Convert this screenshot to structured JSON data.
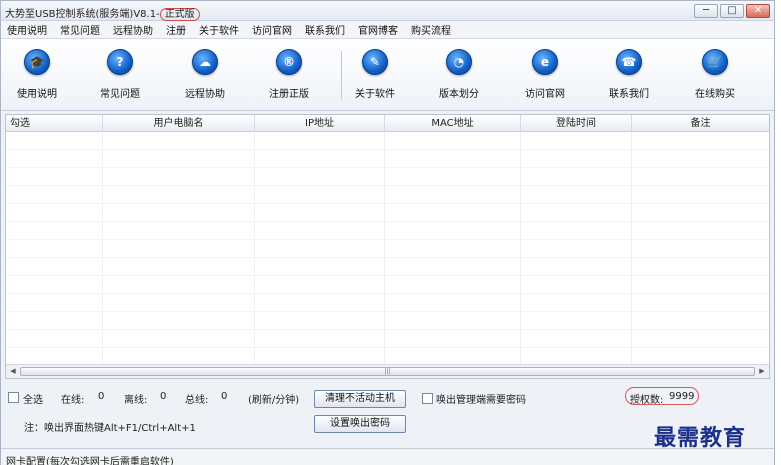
{
  "window": {
    "title_main": "大势至USB控制系统(服务端)V8.1-",
    "title_edition": "正式版",
    "controls": {
      "minimize": "─",
      "maximize": "□",
      "close": "✕"
    }
  },
  "menu": [
    "使用说明",
    "常见问题",
    "远程协助",
    "注册",
    "关于软件",
    "访问官网",
    "联系我们",
    "官网博客",
    "购买流程"
  ],
  "toolbar": {
    "buttons": [
      {
        "label": "使用说明",
        "icon": "graduation-cap-icon",
        "glyph": "🎓"
      },
      {
        "label": "常见问题",
        "icon": "question-icon",
        "glyph": "?"
      },
      {
        "label": "远程协助",
        "icon": "remote-assist-icon",
        "glyph": "☁"
      },
      {
        "label": "注册正版",
        "icon": "registered-icon",
        "glyph": "®"
      },
      {
        "label": "关于软件",
        "icon": "pen-icon",
        "glyph": "✎"
      },
      {
        "label": "版本划分",
        "icon": "pie-chart-icon",
        "glyph": "◔"
      },
      {
        "label": "访问官网",
        "icon": "browser-icon",
        "glyph": "e"
      },
      {
        "label": "联系我们",
        "icon": "phone-icon",
        "glyph": "☎"
      },
      {
        "label": "在线购买",
        "icon": "cart-icon",
        "glyph": "🛒"
      }
    ]
  },
  "grid": {
    "columns": [
      "勾选",
      "用户电脑名",
      "IP地址",
      "MAC地址",
      "登陆时间",
      "备注"
    ],
    "scroll_grip": "|||"
  },
  "status": {
    "select_all": "全选",
    "online_label": "在线:",
    "online_value": "0",
    "offline_label": "离线:",
    "offline_value": "0",
    "total_label": "总线:",
    "total_value": "0",
    "refresh": "(刷新/分钟)",
    "clear_button": "清理不活动主机",
    "password_check": "唤出管理端需要密码",
    "auth_label": "授权数:",
    "auth_value": "9999",
    "hotkey_note": "注：唤出界面热键Alt+F1/Ctrl+Alt+1",
    "set_password_button": "设置唤出密码"
  },
  "footer": {
    "nic_config": "网卡配置(每次勾选网卡后需重启软件)"
  },
  "watermark": "最需教育",
  "colors": {
    "icon_blue": "#0f5fc8",
    "highlight_red": "#d24a4a",
    "watermark_blue": "#1b2f8c"
  }
}
